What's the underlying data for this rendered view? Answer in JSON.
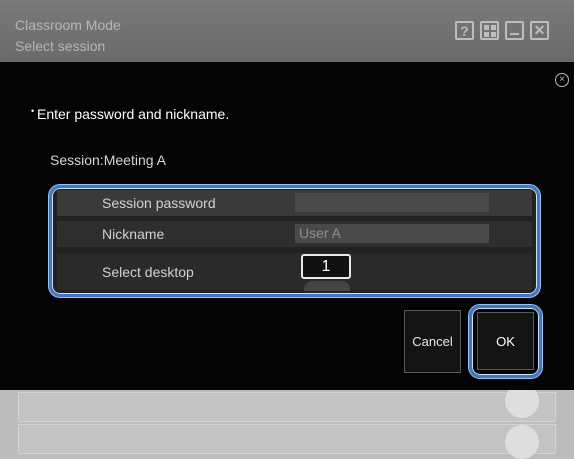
{
  "window": {
    "title": "Classroom Mode",
    "subtitle": "Select session",
    "controls": {
      "help_label": "?",
      "grid_icon": "grid-icon",
      "minimize_icon": "minimize-icon",
      "close_label": "✕"
    }
  },
  "dialog": {
    "close_label": "×",
    "bullet": "•",
    "instruction": "Enter password and nickname.",
    "session_prefix": "Session:",
    "session_name": "Meeting A",
    "fields": {
      "password_label": "Session password",
      "password_value": "",
      "nickname_label": "Nickname",
      "nickname_value": "User A",
      "desktop_label": "Select desktop",
      "desktop_value": "1"
    },
    "buttons": {
      "cancel": "Cancel",
      "ok": "OK"
    },
    "accent_color": "#3e7ac3"
  }
}
